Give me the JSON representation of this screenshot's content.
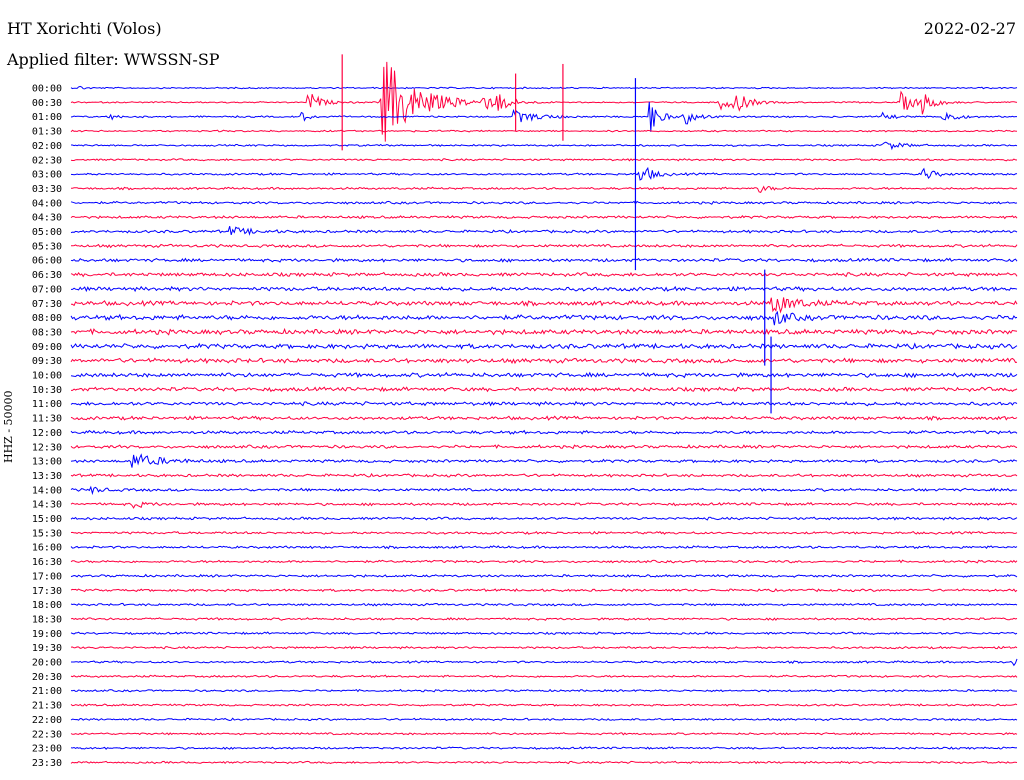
{
  "header": {
    "station": "HT Xorichti (Volos)",
    "filter": "Applied filter: WWSSN-SP",
    "date": "2022-02-27"
  },
  "channel_label": "HHZ - 50000",
  "colors": {
    "trace_a": "#0000ff",
    "trace_b": "#ff0040",
    "background": "#ffffff",
    "text": "#000000"
  },
  "chart_data": {
    "type": "line",
    "title": "HT Xorichti (Volos)",
    "subtitle": "Applied filter: WWSSN-SP",
    "ylabel": "HHZ - 50000",
    "xlabel": "",
    "grid": false,
    "row_labels": [
      "00:00",
      "00:30",
      "01:00",
      "01:30",
      "02:00",
      "02:30",
      "03:00",
      "03:30",
      "04:00",
      "04:30",
      "05:00",
      "05:30",
      "06:00",
      "06:30",
      "07:00",
      "07:30",
      "08:00",
      "08:30",
      "09:00",
      "09:30",
      "10:00",
      "10:30",
      "11:00",
      "11:30",
      "12:00",
      "12:30",
      "13:00",
      "13:30",
      "14:00",
      "14:30",
      "15:00",
      "15:30",
      "16:00",
      "16:30",
      "17:00",
      "17:30",
      "18:00",
      "18:30",
      "19:00",
      "19:30",
      "20:00",
      "20:30",
      "21:00",
      "21:30",
      "22:00",
      "22:30",
      "23:00",
      "23:30"
    ],
    "row_colors": [
      "trace_a",
      "trace_b"
    ],
    "x_range_minutes": [
      0,
      30
    ],
    "baseline_amplitude": [
      0.18,
      0.18,
      0.2,
      0.2,
      0.22,
      0.24,
      0.25,
      0.27,
      0.3,
      0.32,
      0.34,
      0.36,
      0.4,
      0.45,
      0.5,
      0.55,
      0.6,
      0.6,
      0.58,
      0.55,
      0.52,
      0.48,
      0.45,
      0.42,
      0.4,
      0.38,
      0.36,
      0.35,
      0.34,
      0.33,
      0.32,
      0.3,
      0.3,
      0.3,
      0.3,
      0.3,
      0.28,
      0.28,
      0.27,
      0.27,
      0.26,
      0.26,
      0.25,
      0.25,
      0.25,
      0.25,
      0.25,
      0.25
    ],
    "events": [
      {
        "row": 0,
        "minute": 0.2,
        "amplitude": 1.2,
        "duration": 0.2
      },
      {
        "row": 1,
        "minute": 9.8,
        "amplitude": 16,
        "duration": 1.5
      },
      {
        "row": 1,
        "minute": 7.5,
        "amplitude": 4,
        "duration": 0.5
      },
      {
        "row": 1,
        "minute": 13.0,
        "amplitude": 3,
        "duration": 0.5
      },
      {
        "row": 1,
        "minute": 13.5,
        "amplitude": 3,
        "duration": 0.5
      },
      {
        "row": 1,
        "minute": 20.5,
        "amplitude": 3,
        "duration": 0.6
      },
      {
        "row": 1,
        "minute": 21.0,
        "amplitude": 3.5,
        "duration": 0.6
      },
      {
        "row": 1,
        "minute": 26.3,
        "amplitude": 3.5,
        "duration": 0.7
      },
      {
        "row": 1,
        "minute": 27.0,
        "amplitude": 3,
        "duration": 0.5
      },
      {
        "row": 2,
        "minute": 1.2,
        "amplitude": 1.3,
        "duration": 0.3
      },
      {
        "row": 2,
        "minute": 7.3,
        "amplitude": 1.5,
        "duration": 0.4
      },
      {
        "row": 2,
        "minute": 14.0,
        "amplitude": 2,
        "duration": 1.2
      },
      {
        "row": 2,
        "minute": 18.3,
        "amplitude": 8,
        "duration": 0.4
      },
      {
        "row": 2,
        "minute": 19.4,
        "amplitude": 3,
        "duration": 0.6
      },
      {
        "row": 2,
        "minute": 25.7,
        "amplitude": 1.5,
        "duration": 0.4
      },
      {
        "row": 2,
        "minute": 27.6,
        "amplitude": 3,
        "duration": 0.5
      },
      {
        "row": 4,
        "minute": 25.7,
        "amplitude": 1.6,
        "duration": 0.8
      },
      {
        "row": 6,
        "minute": 18.0,
        "amplitude": 3.5,
        "duration": 0.6
      },
      {
        "row": 6,
        "minute": 27.0,
        "amplitude": 2.2,
        "duration": 0.5
      },
      {
        "row": 7,
        "minute": 21.8,
        "amplitude": 1.5,
        "duration": 0.4
      },
      {
        "row": 10,
        "minute": 5.0,
        "amplitude": 1.5,
        "duration": 0.9
      },
      {
        "row": 15,
        "minute": 22.2,
        "amplitude": 3.5,
        "duration": 1.0
      },
      {
        "row": 16,
        "minute": 22.3,
        "amplitude": 2.5,
        "duration": 0.6
      },
      {
        "row": 26,
        "minute": 1.9,
        "amplitude": 2.5,
        "duration": 1.2
      },
      {
        "row": 28,
        "minute": 0.6,
        "amplitude": 1.2,
        "duration": 0.5
      },
      {
        "row": 29,
        "minute": 1.9,
        "amplitude": 1.2,
        "duration": 0.6
      },
      {
        "row": 40,
        "minute": 29.9,
        "amplitude": 1.5,
        "duration": 0.2
      }
    ],
    "spikes": [
      {
        "row": 1,
        "minute": 8.6,
        "amplitude": 5
      },
      {
        "row": 1,
        "minute": 14.1,
        "amplitude": 3
      },
      {
        "row": 1,
        "minute": 15.6,
        "amplitude": 4
      },
      {
        "row": 6,
        "minute": 17.9,
        "amplitude": 10
      },
      {
        "row": 16,
        "minute": 22.0,
        "amplitude": 5
      },
      {
        "row": 20,
        "minute": 22.2,
        "amplitude": 4
      }
    ]
  }
}
